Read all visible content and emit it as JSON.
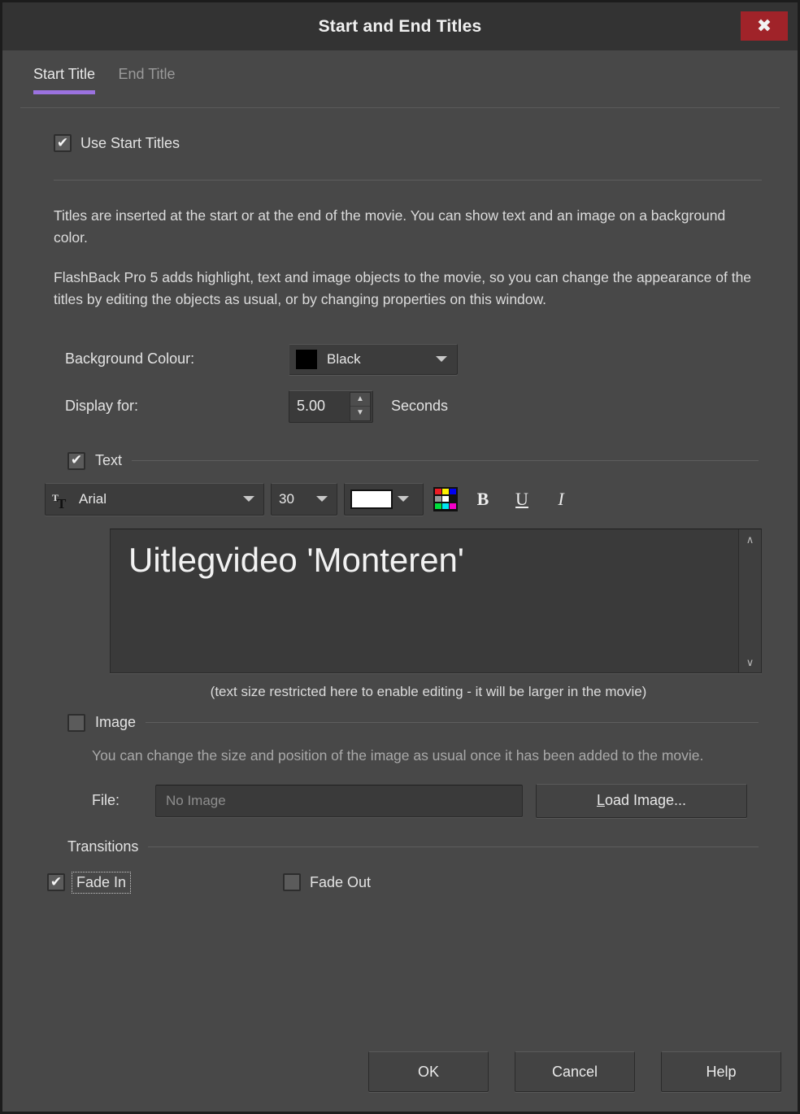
{
  "window": {
    "title": "Start and End Titles",
    "close_icon": "close-icon",
    "close_glyph": "✖",
    "accent_color": "#9b72e0",
    "close_button_color": "#a02329"
  },
  "tabs": [
    {
      "label": "Start Title",
      "active": true
    },
    {
      "label": "End Title",
      "active": false
    }
  ],
  "use_start_titles": {
    "label": "Use Start Titles",
    "checked": true,
    "check_glyph": "✔"
  },
  "description": {
    "paragraph_1": "Titles are inserted at the start or at the end of the movie. You can show text and an image on a background color.",
    "paragraph_2": "FlashBack Pro 5 adds highlight, text and image objects to the movie, so you can change the appearance of the titles by editing the objects as usual, or by changing properties on this window."
  },
  "background_colour": {
    "label": "Background Colour:",
    "value": "Black",
    "swatch_hex": "#000000",
    "caret_icon": "chevron-down-icon"
  },
  "display_for": {
    "label": "Display for:",
    "value": "5.00",
    "unit": "Seconds",
    "up_glyph": "▲",
    "down_glyph": "▼"
  },
  "text_section": {
    "label": "Text",
    "checked": true,
    "check_glyph": "✔",
    "font_family": "Arial",
    "font_size": "30",
    "font_color_hex": "#ffffff",
    "font_icon": "font-TT-icon",
    "palette_icon": "color-palette-icon",
    "palette_colors": [
      "#ed1c24",
      "#fff200",
      "#0000f0",
      "#9a9a9a",
      "#ffffff",
      "#111111",
      "#00e03c",
      "#00e5f0",
      "#f500c8"
    ],
    "bold_label": "B",
    "underline_label": "U",
    "italic_label": "I",
    "content": "Uitlegvideo 'Monteren'",
    "scroll_up_glyph": "∧",
    "scroll_down_glyph": "∨",
    "restriction_note": "(text size restricted here to enable editing - it will be larger in the movie)"
  },
  "image_section": {
    "label": "Image",
    "checked": false,
    "check_glyph": "✔",
    "description": "You can change the size and position of the image as usual once it has been added to the movie.",
    "file_label": "File:",
    "file_placeholder": "No Image",
    "load_button_prefix": "L",
    "load_button_rest": "oad Image..."
  },
  "transitions": {
    "label": "Transitions",
    "fade_in": {
      "label": "Fade In",
      "checked": true,
      "check_glyph": "✔",
      "focused": true
    },
    "fade_out": {
      "label": "Fade Out",
      "checked": false,
      "check_glyph": "✔",
      "focused": false
    }
  },
  "footer": {
    "ok_label": "OK",
    "cancel_label": "Cancel",
    "help_label": "Help"
  }
}
